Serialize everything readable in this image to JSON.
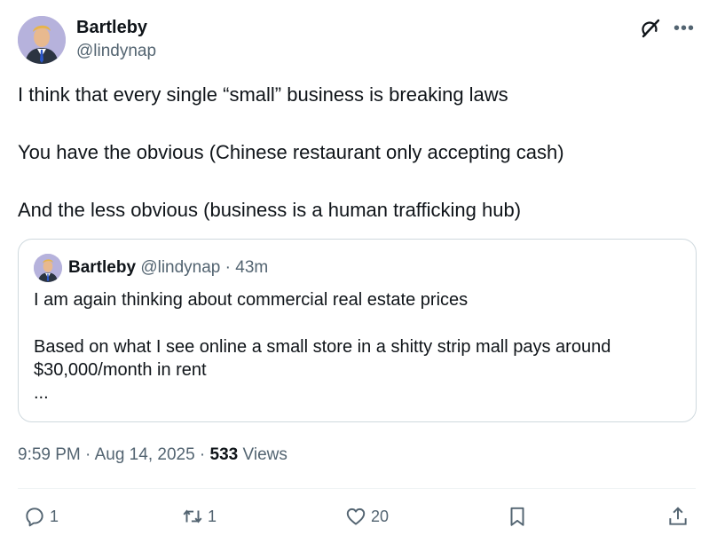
{
  "post": {
    "author": {
      "display_name": "Bartleby",
      "handle": "@lindynap"
    },
    "body_lines": [
      "I think that every single “small” business is breaking laws",
      "You have the obvious (Chinese restaurant only accepting cash)",
      "And the less obvious (business is a human trafficking hub)"
    ],
    "timestamp": "9:59 PM · Aug 14, 2025",
    "separator": " · ",
    "views_count": "533",
    "views_label": "Views"
  },
  "quote": {
    "display_name": "Bartleby",
    "handle": "@lindynap",
    "time": "· 43m",
    "lines": [
      "I am again thinking about commercial real estate prices",
      "Based on what I see online a small store in a shitty strip mall pays around",
      "$30,000/month in rent",
      "..."
    ]
  },
  "actions": {
    "replies": "1",
    "reposts": "1",
    "likes": "20"
  },
  "icons": {
    "top": [
      "grok-icon",
      "more-icon"
    ],
    "bar": [
      "reply-icon",
      "repost-icon",
      "like-icon",
      "bookmark-icon",
      "share-icon"
    ]
  },
  "colors": {
    "text_primary": "#0f1419",
    "text_secondary": "#536471",
    "border": "#cfd9de",
    "avatar_bg": "#b6b2dc"
  }
}
